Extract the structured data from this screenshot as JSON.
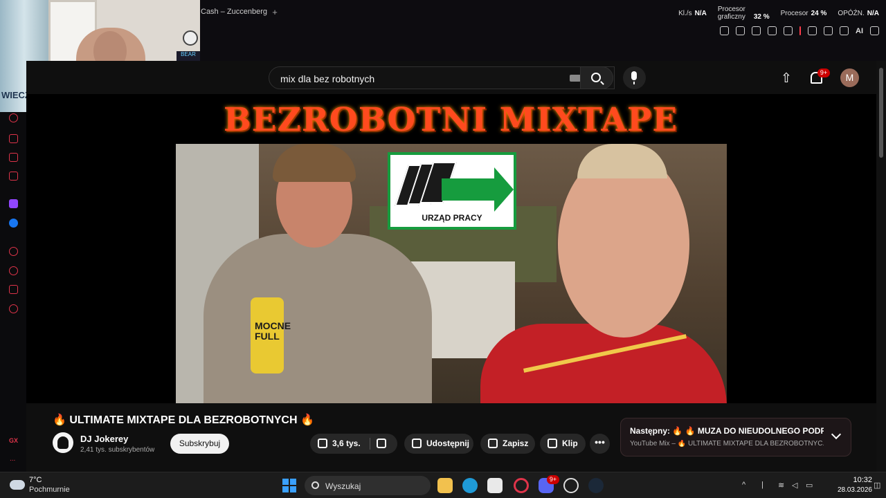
{
  "browser": {
    "tab_title": "Cash – Zuccenberg",
    "new_tab": "+",
    "stats": [
      {
        "label": "Kl./s",
        "value": "N/A"
      },
      {
        "label": "Procesor graficzny",
        "value": "32 %"
      },
      {
        "label": "Procesor",
        "value": "24 %"
      },
      {
        "label": "OPÓŹN.",
        "value": "N/A"
      }
    ],
    "ai_label": "AI",
    "gx_label": "GX",
    "sidebar_more": "..."
  },
  "webcam": {
    "bottle_label": "WIECZDRO",
    "lamp_text": "BEAR"
  },
  "youtube": {
    "search": {
      "value": "mix dla bez robotnych",
      "clear": "✕"
    },
    "notifications_badge": "9+",
    "avatar_letter": "M",
    "upload_icon": "⇧"
  },
  "thumbnail": {
    "headline": "BEZROBOTNI MIXTAPE",
    "sign_label": "URZĄD PRACY",
    "can_text": "MOCNE FULL"
  },
  "video": {
    "title": "🔥 ULTIMATE MIXTAPE DLA BEZROBOTNYCH 🔥",
    "channel": "DJ Jokerey",
    "subscribers": "2,41 tys. subskrybentów",
    "subscribe": "Subskrybuj",
    "likes": "3,6 tys.",
    "share": "Udostępnij",
    "save": "Zapisz",
    "clip": "Klip",
    "more": "•••"
  },
  "up_next": {
    "title": "Następny: 🔥 🔥 MUZA DO NIEUDOLNEGO PODRY...",
    "subtitle": "YouTube Mix – 🔥 ULTIMATE MIXTAPE DLA BEZROBOTNYC..."
  },
  "taskbar": {
    "temperature": "7°C",
    "condition": "Pochmurnie",
    "search_label": "Wyszukaj",
    "time": "10:32",
    "date": "28.03.2026",
    "discord_badge": "9+"
  },
  "colors": {
    "accent": "#e0344a",
    "youtube_red": "#cc0000",
    "urzad_green": "#169c3e"
  }
}
